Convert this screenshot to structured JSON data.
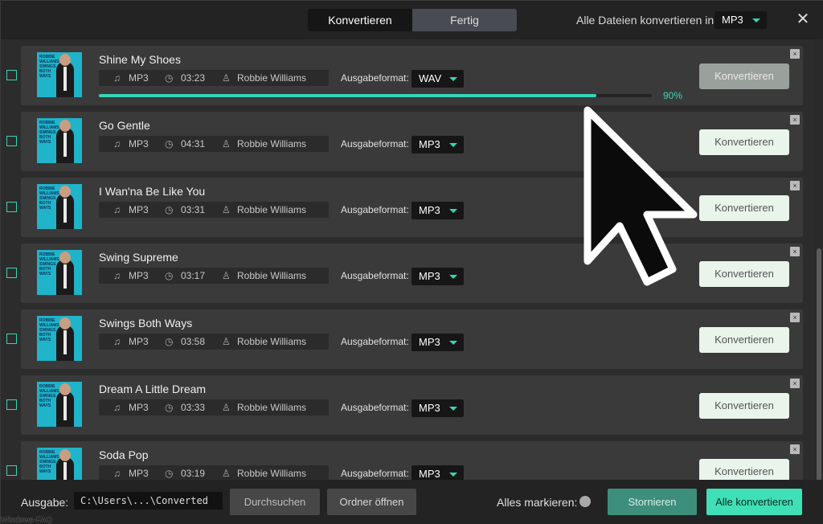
{
  "header": {
    "tabs": [
      {
        "label": "Konvertieren",
        "active": true
      },
      {
        "label": "Fertig",
        "active": false
      }
    ],
    "convert_all_label": "Alle Dateien konvertieren in:",
    "convert_all_format": "MP3",
    "close_icon": "close-icon"
  },
  "common": {
    "format_label": "Ausgabeformat:",
    "convert_button": "Konvertieren",
    "remove_icon": "×",
    "album_cover_text": "ROBBIE WILLIAMS SWINGS BOTH WAYS"
  },
  "tracks": [
    {
      "title": "Shine My Shoes",
      "type": "MP3",
      "duration": "03:23",
      "artist": "Robbie Williams",
      "output_format": "WAV",
      "progress": 0.9,
      "progress_label": "90%",
      "converting": true
    },
    {
      "title": "Go Gentle",
      "type": "MP3",
      "duration": "04:31",
      "artist": "Robbie Williams",
      "output_format": "MP3"
    },
    {
      "title": "I Wan'na Be Like You",
      "type": "MP3",
      "duration": "03:31",
      "artist": "Robbie Williams",
      "output_format": "MP3"
    },
    {
      "title": "Swing Supreme",
      "type": "MP3",
      "duration": "03:17",
      "artist": "Robbie Williams",
      "output_format": "MP3"
    },
    {
      "title": "Swings Both Ways",
      "type": "MP3",
      "duration": "03:58",
      "artist": "Robbie Williams",
      "output_format": "MP3"
    },
    {
      "title": "Dream A Little Dream",
      "type": "MP3",
      "duration": "03:33",
      "artist": "Robbie Williams",
      "output_format": "MP3"
    },
    {
      "title": "Soda Pop",
      "type": "MP3",
      "duration": "03:19",
      "artist": "Robbie Williams",
      "output_format": "MP3"
    }
  ],
  "footer": {
    "output_label": "Ausgabe:",
    "output_path": "C:\\Users\\...\\Converted",
    "browse_button": "Durchsuchen",
    "open_folder_button": "Ordner öffnen",
    "mark_all_label": "Alles markieren:",
    "cancel_button": "Stornieren",
    "convert_all_button": "Alle konvertieren"
  },
  "watermark": "Windows-FAQ",
  "colors": {
    "accent": "#35d6b6",
    "background": "#2c2c2c",
    "card": "#3a3a3a"
  }
}
